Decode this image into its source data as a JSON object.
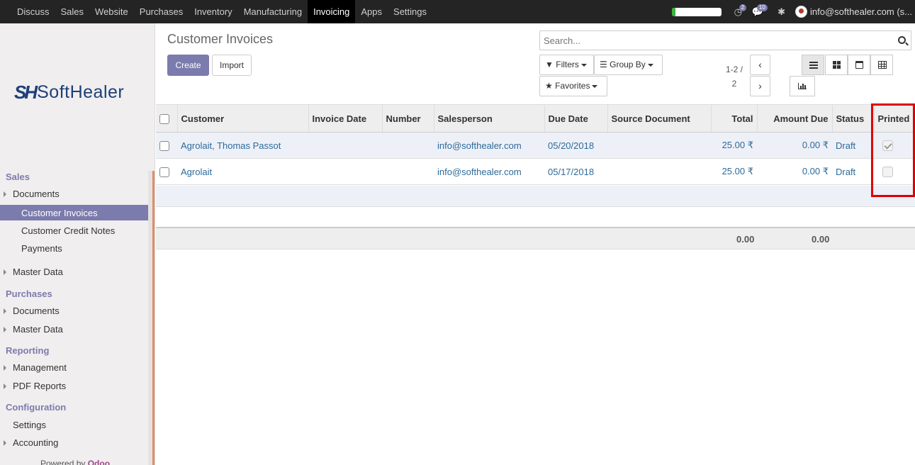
{
  "topbar": {
    "menu": [
      "Discuss",
      "Sales",
      "Website",
      "Purchases",
      "Inventory",
      "Manufacturing",
      "Invoicing",
      "Apps",
      "Settings"
    ],
    "active_menu": "Invoicing",
    "activity_count": "2",
    "message_count": "10",
    "user": "info@softhealer.com (s..."
  },
  "sidebar": {
    "logo_mark": "SH",
    "logo_text": "SoftHealer",
    "sales_title": "Sales",
    "sales_documents": "Documents",
    "customer_invoices": "Customer Invoices",
    "customer_credit_notes": "Customer Credit Notes",
    "payments": "Payments",
    "sales_master_data": "Master Data",
    "purchases_title": "Purchases",
    "purchases_documents": "Documents",
    "purchases_master_data": "Master Data",
    "reporting_title": "Reporting",
    "management": "Management",
    "pdf_reports": "PDF Reports",
    "configuration_title": "Configuration",
    "settings": "Settings",
    "accounting": "Accounting",
    "powered_by": "Powered by",
    "powered_brand": "Odoo"
  },
  "control": {
    "title": "Customer Invoices",
    "create": "Create",
    "import": "Import",
    "search_placeholder": "Search...",
    "filters": "Filters",
    "group_by": "Group By",
    "favorites": "Favorites",
    "pager_top": "1-2 /",
    "pager_bottom": "2"
  },
  "table": {
    "headers": {
      "customer": "Customer",
      "invoice_date": "Invoice Date",
      "number": "Number",
      "salesperson": "Salesperson",
      "due_date": "Due Date",
      "source_document": "Source Document",
      "total": "Total",
      "amount_due": "Amount Due",
      "status": "Status",
      "printed": "Printed"
    },
    "rows": [
      {
        "customer": "Agrolait, Thomas Passot",
        "invoice_date": "",
        "number": "",
        "salesperson": "info@softhealer.com",
        "due_date": "05/20/2018",
        "source_document": "",
        "total": "25.00 ₹",
        "amount_due": "0.00 ₹",
        "status": "Draft",
        "printed": true
      },
      {
        "customer": "Agrolait",
        "invoice_date": "",
        "number": "",
        "salesperson": "info@softhealer.com",
        "due_date": "05/17/2018",
        "source_document": "",
        "total": "25.00 ₹",
        "amount_due": "0.00 ₹",
        "status": "Draft",
        "printed": false
      }
    ],
    "footer": {
      "total": "0.00",
      "amount_due": "0.00"
    }
  },
  "colors": {
    "accent": "#7c7bad",
    "highlight": "#e00000",
    "progress": "#3bb43b"
  },
  "progress_fraction": 0.08
}
